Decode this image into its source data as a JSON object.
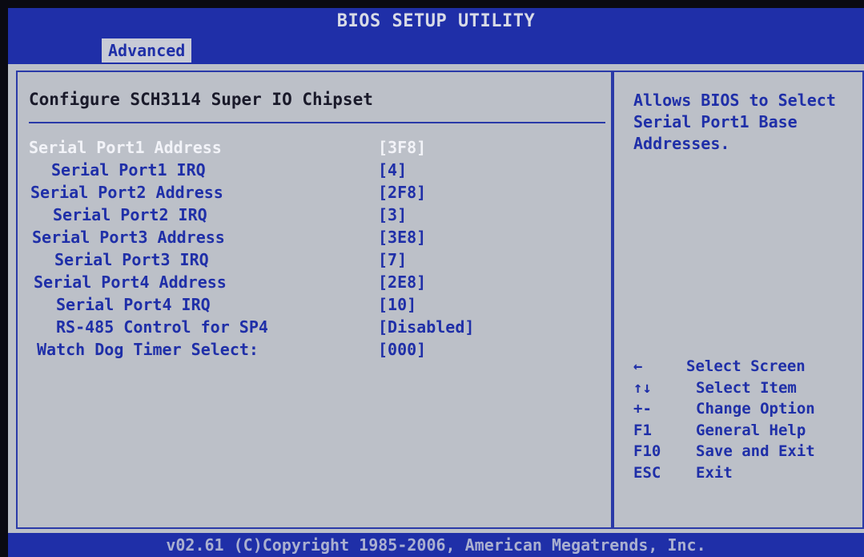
{
  "header": {
    "title": "BIOS SETUP UTILITY"
  },
  "tabs": [
    {
      "label": "Advanced",
      "active": true
    }
  ],
  "section": {
    "title": "Configure SCH3114 Super IO Chipset"
  },
  "settings": [
    {
      "label": "Serial Port1 Address",
      "value": "[3F8]",
      "selected": true
    },
    {
      "label": "Serial Port1 IRQ",
      "value": "[4]"
    },
    {
      "label": "Serial Port2 Address",
      "value": "[2F8]"
    },
    {
      "label": "Serial Port2 IRQ",
      "value": "[3]"
    },
    {
      "label": "Serial Port3 Address",
      "value": "[3E8]"
    },
    {
      "label": "Serial Port3 IRQ",
      "value": "[7]"
    },
    {
      "label": "Serial Port4 Address",
      "value": "[2E8]"
    },
    {
      "label": "Serial Port4 IRQ",
      "value": "[10]"
    },
    {
      "label": "RS-485 Control for SP4",
      "value": "[Disabled]"
    },
    {
      "label": "Watch Dog Timer Select:",
      "value": "[000]"
    }
  ],
  "help": {
    "text": "Allows BIOS to Select\nSerial Port1 Base\nAddresses."
  },
  "keys": [
    {
      "key": "←",
      "desc": "Select Screen"
    },
    {
      "key": "↑↓",
      "desc": "Select Item"
    },
    {
      "key": "+-",
      "desc": "Change Option"
    },
    {
      "key": "F1",
      "desc": "General Help"
    },
    {
      "key": "F10",
      "desc": "Save and Exit"
    },
    {
      "key": "ESC",
      "desc": "Exit"
    }
  ],
  "footer": {
    "copyright": "v02.61 (C)Copyright 1985-2006, American Megatrends, Inc."
  },
  "colors": {
    "bios_blue": "#1f2fa8",
    "panel_grey": "#bcc0c8",
    "highlight_white": "#f2f3f8"
  }
}
